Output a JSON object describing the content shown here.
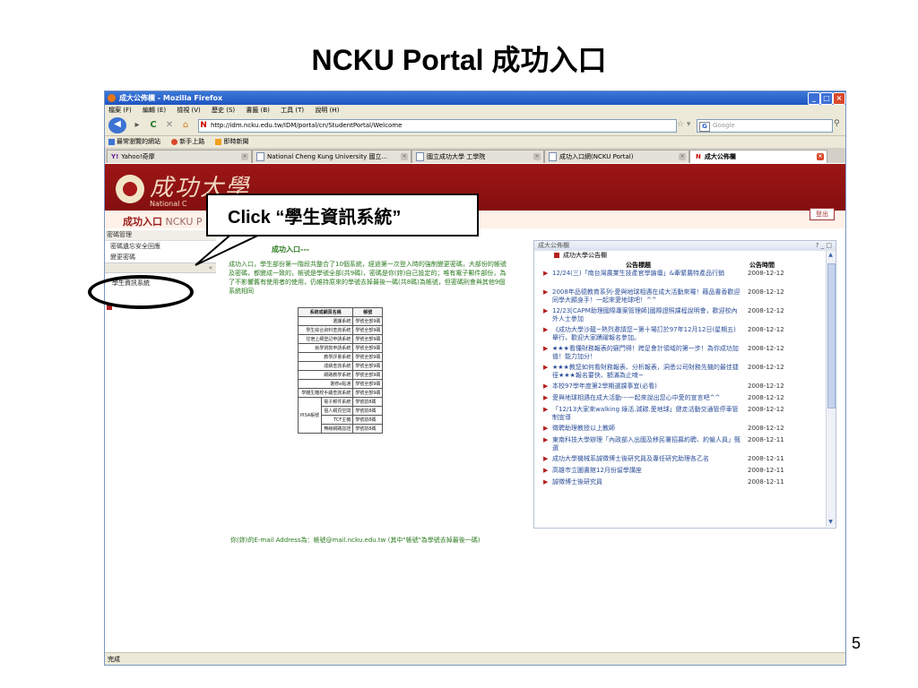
{
  "slide": {
    "title": "NCKU Portal 成功入口",
    "number": "5",
    "callout": "Click “學生資訊系統”"
  },
  "browser": {
    "window_title": "成大公佈欄 - Mozilla Firefox",
    "menu": [
      "檔案 (F)",
      "編輯 (E)",
      "檢視 (V)",
      "歷史 (S)",
      "書籤 (B)",
      "工具 (T)",
      "說明 (H)"
    ],
    "url": "http://idm.ncku.edu.tw/IDM/portal/cn/StudentPortal/Welcome",
    "search_placeholder": "Google",
    "bookmarks": [
      "最常瀏覽的網站",
      "新手上路",
      "即時新聞"
    ],
    "tabs": [
      {
        "label": "Yahoo!奇摩"
      },
      {
        "label": "National Cheng Kung University 國立..."
      },
      {
        "label": "國立成功大學 工學院"
      },
      {
        "label": "成功入口網(NCKU Portal)"
      },
      {
        "label": "成大公佈欄"
      }
    ],
    "status": "完成"
  },
  "portal": {
    "logo_text": "成功大學",
    "logo_sub": "National C",
    "name": "成功入口",
    "name_en": " NCKU P",
    "logout": "登出",
    "sidebar": {
      "header": "密碼管理",
      "items": [
        "密碼遺忘安全回應",
        "變更密碼"
      ],
      "system": "學生資訊系統"
    },
    "welcome": "成功入口---",
    "intro": "成功入口，學生部份第一階段共整合了10個系統，經過第一次登入時的強制變更密碼，大部份的帳號及密碼，都變成一致的，帳號是學號全部(共9碼)，密碼是你(妳)自己設定的；唯有電子郵件部份，為了不影響舊有使用者的使用，仍維持原來的學號去掉最後一碼(共8碼)為帳號，但密碼則會與其他9個系統相同",
    "table": {
      "headers": [
        "系統或網頁名稱",
        "帳號"
      ],
      "rows": [
        [
          "選課系統",
          "學號全部9碼"
        ],
        [
          "學生綜合資料查詢系統",
          "學號全部9碼"
        ],
        [
          "住宿上網登記申請系統",
          "學號全部9碼"
        ],
        [
          "就學貸款申請系統",
          "學號全部9碼"
        ],
        [
          "教學評量系統",
          "學號全部9碼"
        ],
        [
          "成績查詢系統",
          "學號全部9碼"
        ],
        [
          "網路教學系統",
          "學號全部9碼"
        ],
        [
          "選修e點通",
          "學號全部9碼"
        ],
        [
          "學雜生離校手續查詢系統",
          "學號全部9碼"
        ]
      ],
      "pisa_label": "PISA帳號",
      "pisa_rows": [
        [
          "電子郵件系統",
          "學號前8碼"
        ],
        [
          "個人網頁空間",
          "學號前8碼"
        ],
        [
          "TCF主機",
          "學號前8碼"
        ],
        [
          "無線網路認證",
          "學號前8碼"
        ]
      ]
    },
    "email_note": "你(妳)的E-mail Address為：帳號@mail.ncku.edu.tw (其中\"帳號\"為學號去掉最後一碼)",
    "announcements": {
      "panel_title": "成大公佈欄",
      "panel_ctrl": "? _ □",
      "subtitle": "成功大學公告欄",
      "col_title": "公告標題",
      "col_time": "公告時間",
      "items": [
        {
          "title": "12/24(三)「南台灣農業生技產官學論壇」&牽緊農特產品行銷",
          "date": "2008-12-12"
        },
        {
          "title": "2008年品德教育系列-愛與地球相遇在成大活動來囉！藉品書香歡迎同學大顯身手！一起來愛地球吧！^^",
          "date": "2008-12-12"
        },
        {
          "title": "12/23[CAPM助理國際專案管理師]國際證照課程說明會，歡迎校內外人士參加",
          "date": "2008-12-12"
        },
        {
          "title": "《成功大學沙龍~熱烈邀請您~第十場訂於97年12月12日(星期五)舉行，歡迎大家踴躍報名參加。",
          "date": "2008-12-12"
        },
        {
          "title": "★★★看懂財務報表的竅門得！跨足會計領域的第一步！為你成功加值！能力加分！",
          "date": "2008-12-12"
        },
        {
          "title": "★★★教您如何看財務報表、分析報表，洞悉公司財務先機的最佳捷徑★★★報名要快、額滿為止唷~",
          "date": "2008-12-12"
        },
        {
          "title": "本校97學年度第2學期選課事宜(必看)",
          "date": "2008-12-12"
        },
        {
          "title": "愛與地球相遇在成大活動---一起來說出您心中愛的宣言吧^^",
          "date": "2008-12-12"
        },
        {
          "title": "「12/13大家來walking 綠活.減碳.愛地球」健走活動交通管停車管制宣導",
          "date": "2008-12-12"
        },
        {
          "title": "徵聘助理教授以上教師",
          "date": "2008-12-12"
        },
        {
          "title": "東南科技大學辦理「內政部入出國及移民署招募約聘、約僱人員」甄選",
          "date": "2008-12-11"
        },
        {
          "title": "成功大學機械系誠徵博士後研究員及專任研究助理各乙名",
          "date": "2008-12-11"
        },
        {
          "title": "高雄市立圖書館12月份留學講座",
          "date": "2008-12-11"
        },
        {
          "title": "誠徵博士後研究員",
          "date": "2008-12-11"
        }
      ]
    }
  }
}
